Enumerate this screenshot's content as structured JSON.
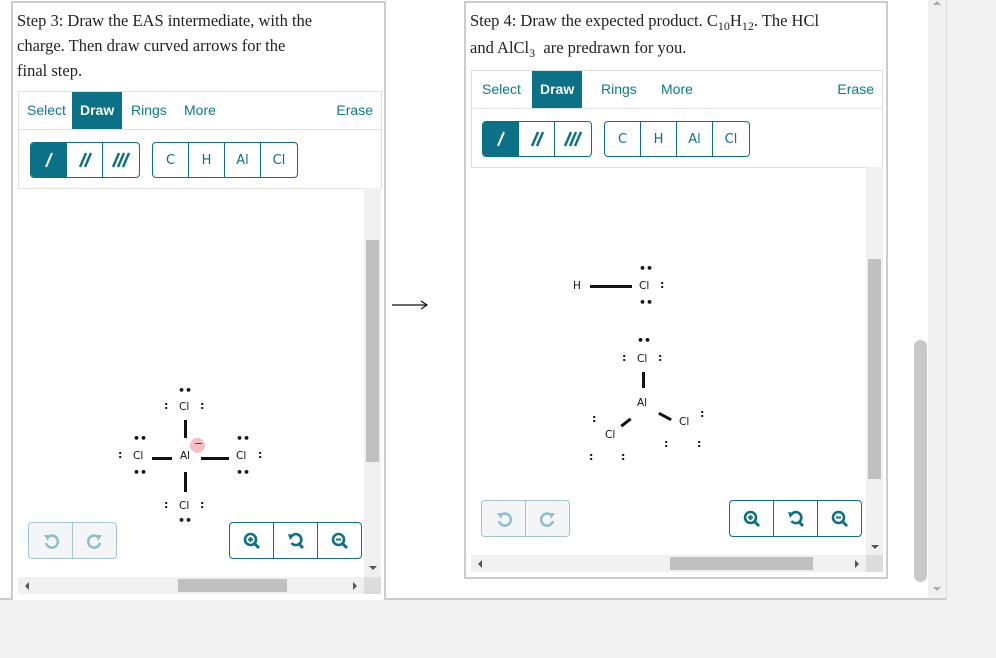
{
  "step3": {
    "prompt_line1": "Step 3: Draw the EAS intermediate, with the",
    "prompt_line2": "charge. Then draw curved arrows for the",
    "prompt_line3": "final step."
  },
  "step4": {
    "prompt_a": "Step 4: Draw the expected product. C",
    "prompt_sub1": "10",
    "prompt_b": "H",
    "prompt_sub2": "12",
    "prompt_c": ". The HCl",
    "prompt_d": "and AlCl",
    "prompt_sub3": "3",
    "prompt_e": "  are predrawn for you."
  },
  "toolbar": {
    "tabs": [
      "Select",
      "Draw",
      "Rings",
      "More"
    ],
    "active_tab": "Draw",
    "erase_label": "Erase",
    "bond_tools": [
      "single-bond",
      "double-bond",
      "triple-bond"
    ],
    "active_bond": "single-bond",
    "atoms": [
      "C",
      "H",
      "Al",
      "Cl"
    ]
  },
  "controls": {
    "undo": "undo-icon",
    "redo": "redo-icon",
    "zoom_in": "zoom-in-icon",
    "reset": "reset-zoom-icon",
    "zoom_out": "zoom-out-icon"
  },
  "molecule3": {
    "atoms": {
      "center": "Al",
      "top": "Cl",
      "left": "Cl",
      "right": "Cl",
      "bottom": "Cl"
    },
    "charge": "−"
  },
  "molecule4": {
    "hcl": {
      "h": "H",
      "cl": "Cl"
    },
    "alcl3": {
      "al": "Al",
      "top": "Cl",
      "left": "Cl",
      "right": "Cl"
    }
  },
  "lone_pair_h": "••",
  "lone_pair_v": ":",
  "reaction_arrow": "→"
}
